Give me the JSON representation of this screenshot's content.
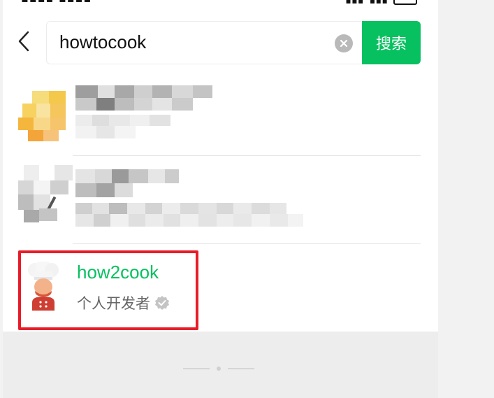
{
  "search": {
    "query": "howtocook",
    "button_label": "搜索"
  },
  "results": [
    {
      "title": "",
      "subtitle": "",
      "obscured": true
    },
    {
      "title": "",
      "subtitle": "",
      "obscured": true
    },
    {
      "title": "how2cook",
      "subtitle": "个人开发者",
      "verified": true,
      "highlighted": true
    }
  ],
  "colors": {
    "accent": "#07c160",
    "highlight_border": "#e81c28",
    "footer_bg": "#ededed"
  }
}
